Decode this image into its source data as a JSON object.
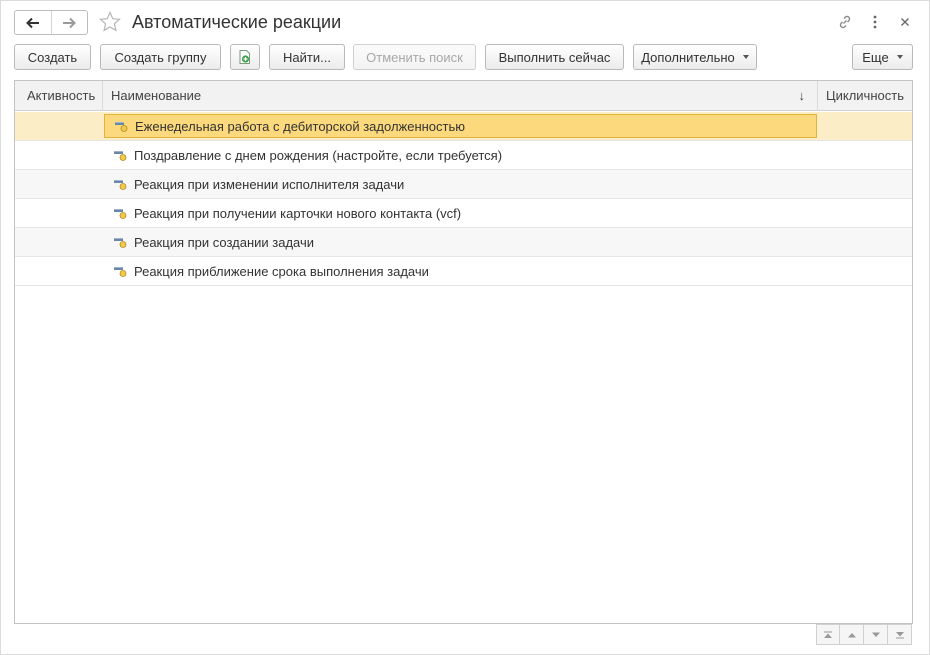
{
  "window": {
    "title": "Автоматические реакции"
  },
  "header": {
    "nav_back_icon": "arrow-left-icon",
    "nav_forward_icon": "arrow-right-icon",
    "favorite_icon": "star-icon",
    "link_icon": "link-icon",
    "more_icon": "vertical-dots-icon",
    "close_icon": "close-icon"
  },
  "toolbar": {
    "create": "Создать",
    "create_group": "Создать группу",
    "add_file_icon": "document-add-icon",
    "find": "Найти...",
    "cancel_search": "Отменить поиск",
    "run_now": "Выполнить сейчас",
    "additional": "Дополнительно",
    "more": "Еще"
  },
  "table": {
    "columns": [
      "Активность",
      "Наименование",
      "Цикличность"
    ],
    "sort_indicator": "↓",
    "rows": [
      {
        "name": "Еженедельная работа с дебиторской задолженностью",
        "selected": true
      },
      {
        "name": "Поздравление с днем рождения (настройте, если требуется)"
      },
      {
        "name": "Реакция при изменении исполнителя задачи"
      },
      {
        "name": "Реакция при получении карточки нового контакта (vcf)"
      },
      {
        "name": "Реакция при создании задачи"
      },
      {
        "name": "Реакция приближение срока выполнения задачи"
      }
    ]
  },
  "scroll_buttons": [
    "scroll-top-icon",
    "scroll-up-icon",
    "scroll-down-icon",
    "scroll-bottom-icon"
  ],
  "colors": {
    "selection_row": "#fbeec6",
    "selection_cell": "#fbd97c",
    "header_bg": "#f2f2f2"
  }
}
